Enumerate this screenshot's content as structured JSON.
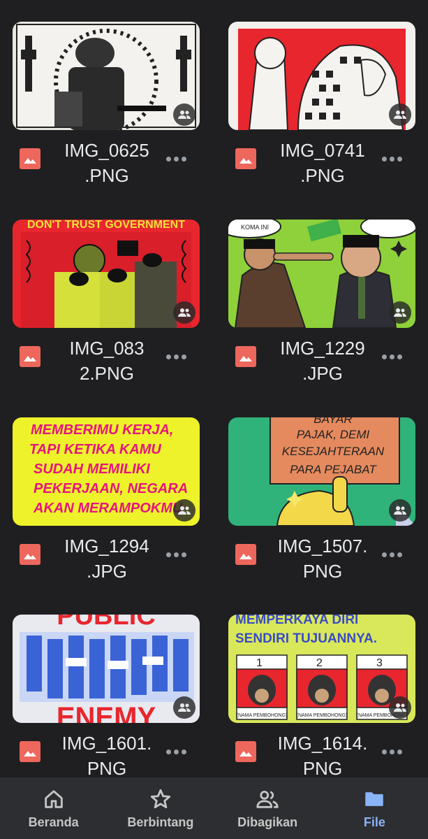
{
  "files": [
    {
      "name": "IMG_0625\n.PNG",
      "shared_icon": "people-icon",
      "type_icon": "image-icon"
    },
    {
      "name": "IMG_0741\n.PNG",
      "shared_icon": "people-icon",
      "type_icon": "image-icon"
    },
    {
      "name": "IMG_083\n2.PNG",
      "shared_icon": "people-icon",
      "type_icon": "image-icon"
    },
    {
      "name": "IMG_1229\n.JPG",
      "shared_icon": "people-icon",
      "type_icon": "image-icon"
    },
    {
      "name": "IMG_1294\n.JPG",
      "shared_icon": "people-icon",
      "type_icon": "image-icon"
    },
    {
      "name": "IMG_1507.\nPNG",
      "shared_icon": "people-icon",
      "type_icon": "image-icon"
    },
    {
      "name": "IMG_1601.\nPNG",
      "shared_icon": "people-icon",
      "type_icon": "image-icon"
    },
    {
      "name": "IMG_1614.\nPNG",
      "shared_icon": "people-icon",
      "type_icon": "image-icon"
    }
  ],
  "thumb_text": {
    "t2_top": "DON'T TRUST GOVERNMENT",
    "t3_bubble": "KOMA INI",
    "t4_lines": [
      "MEMBERIMU KERJA,",
      "TAPI KETIKA KAMU",
      "SUDAH MEMILIKI",
      "PEKERJAAN, NEGARA",
      "AKAN MERAMPOKMU"
    ],
    "t5_lines": [
      "BAYAR",
      "PAJAK, DEMI",
      "KESEJAHTERAAN",
      "PARA PEJABAT"
    ],
    "t6_top": "PUBLIC",
    "t6_bottom": "ENEMY",
    "t7_lines": [
      "MEMPERKAYA DIRI",
      "SENDIRI TUJUANNYA."
    ],
    "t7_numbers": [
      "1",
      "2",
      "3"
    ],
    "t7_caption": "(NAMA PEMBOHONG)"
  },
  "nav": {
    "items": [
      {
        "label": "Beranda",
        "icon": "home-icon",
        "active": false
      },
      {
        "label": "Berbintang",
        "icon": "star-icon",
        "active": false
      },
      {
        "label": "Dibagikan",
        "icon": "people-icon",
        "active": false
      },
      {
        "label": "File",
        "icon": "folder-icon",
        "active": true
      }
    ]
  },
  "colors": {
    "background": "#1f1f21",
    "nav_background": "#2d2e31",
    "active": "#8ab4f8",
    "file_type_icon": "#ee675c",
    "text": "#e8eaed"
  }
}
